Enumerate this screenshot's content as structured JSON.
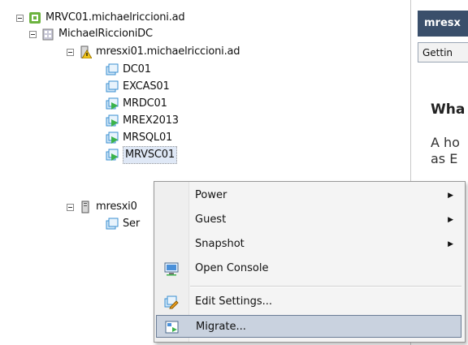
{
  "tree": {
    "root": "MRVC01.michaelriccioni.ad",
    "datacenter": "MichaelRiccioniDC",
    "host1": "mresxi01.michaelriccioni.ad",
    "vms": [
      "DC01",
      "EXCAS01",
      "MRDC01",
      "MREX2013",
      "MRSQL01",
      "MRVSC01"
    ],
    "host2": "mresxi0",
    "host2_vm": "Ser"
  },
  "right_panel": {
    "header": "mresx",
    "tab": "Gettin",
    "heading": "Wha",
    "text_line1": "A ho",
    "text_line2": "as E"
  },
  "context_menu": {
    "items": [
      {
        "label": "Power",
        "submenu": true
      },
      {
        "label": "Guest",
        "submenu": true
      },
      {
        "label": "Snapshot",
        "submenu": true
      },
      {
        "label": "Open Console",
        "submenu": false
      },
      {
        "label": "Edit Settings...",
        "submenu": false
      },
      {
        "label": "Migrate...",
        "submenu": false
      }
    ],
    "arrow_glyph": "▶"
  },
  "colors": {
    "vm_icon": "#3a8fd1",
    "vm_on": "#3bb34a",
    "warning": "#f0c419",
    "menu_highlight": "#c9d2df",
    "panel_header": "#3a4f6b"
  }
}
